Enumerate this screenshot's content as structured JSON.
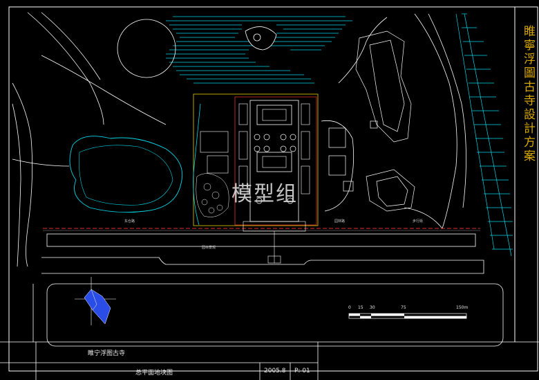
{
  "vertical_title": "睢寧浮圖古寺設計方案",
  "watermark": "模型组",
  "title_block": {
    "project_name": "睢宁浮图古寺",
    "drawing_name": "总平面地块图",
    "date": "2005.8",
    "page_label": "P: 01"
  },
  "scale_bar": {
    "ticks": [
      "0",
      "15",
      "30",
      "75",
      "150m"
    ]
  },
  "annotations": {
    "road_west": "东仓路",
    "road_mid": "园林路",
    "road_east": "步行街",
    "south_label": "园林景观"
  },
  "colors": {
    "background": "#000000",
    "frame": "#ffffff",
    "cyan": "#00d8e8",
    "red_line": "#e03030",
    "yellow": "#d8a800",
    "compass": "#2a4de8"
  }
}
